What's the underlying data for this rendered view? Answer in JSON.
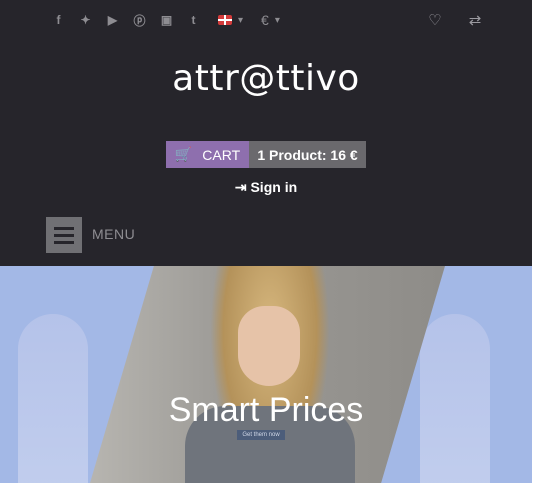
{
  "topbar": {
    "social_icons": [
      "facebook-icon",
      "twitter-icon",
      "youtube-icon",
      "pinterest-icon",
      "instagram-icon",
      "tumblr-icon"
    ],
    "social_glyphs": [
      "f",
      "tw",
      "▶",
      "Ⓟ",
      "▣",
      "t"
    ],
    "currency_symbol": "€",
    "wishlist_icon": "heart-icon",
    "compare_icon": "shuffle-icon"
  },
  "logo": {
    "text": "attr@ttivo"
  },
  "cart": {
    "label": "CART",
    "summary": "1 Product: 16 €"
  },
  "account": {
    "signin_label": "Sign in"
  },
  "menu": {
    "label": "MENU"
  },
  "slider": {
    "title": "Smart Prices",
    "button_label": "Get them now"
  },
  "colors": {
    "header_bg": "#26252b",
    "cart_accent": "#8e6fae",
    "cart_info_bg": "#6a696d",
    "banner_bg": "#a3b8e6"
  }
}
